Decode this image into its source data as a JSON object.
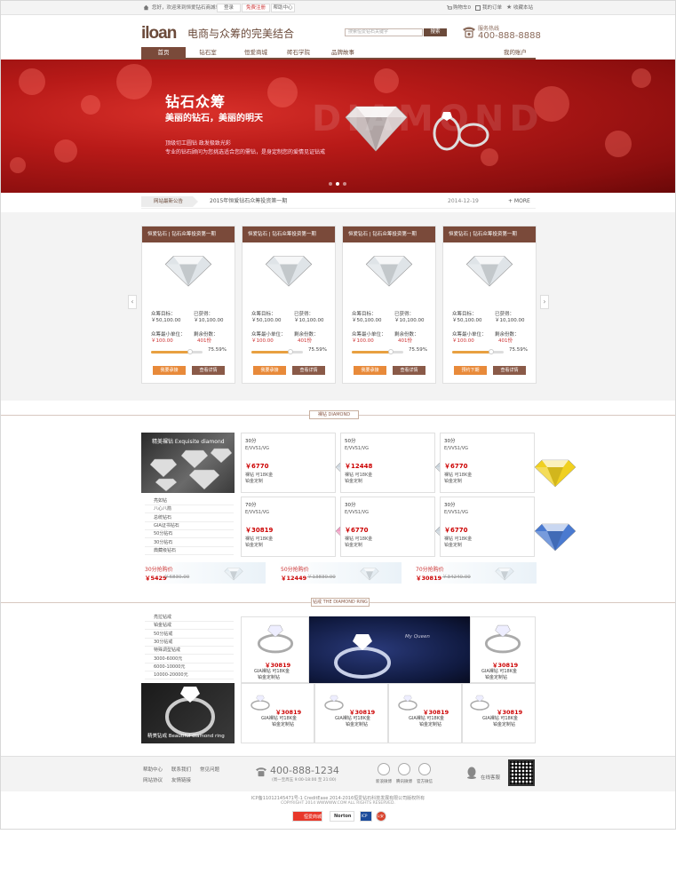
{
  "topbar": {
    "greeting": "您好，欢迎来到恒爱钻石商城！",
    "login": "登录",
    "register": "免费注册",
    "help": "帮助中心",
    "cart": "购物车0",
    "orders": "我的订单",
    "favorite": "收藏本站"
  },
  "header": {
    "logo": "iloan",
    "slogan": "电商与众筹的完美结合",
    "search_placeholder": "搜索恒爱钻石关键字",
    "search_button": "搜索",
    "hotline_label": "服务热线",
    "hotline": "400-888-8888"
  },
  "nav": {
    "items": [
      "首页",
      "钻石室",
      "恒爱商城",
      "砖石学院",
      "品牌故事"
    ],
    "account": "我的账户"
  },
  "banner": {
    "title": "钻石众筹",
    "subtitle": "美丽的钻石，美丽的明天",
    "line1": "顶级切工圆钻    政发极致光彩",
    "line2": "专业的钻石顾问为您挑选适合您的需钻，是身定制您的爱情见证钻戒",
    "bg_text": "DIAMOND"
  },
  "notice": {
    "tag": "网站最新公告",
    "text": "2015年恒爱钻石众筹投资第一期",
    "date": "2014-12-19",
    "more": "+ MORE"
  },
  "funding": {
    "labels": {
      "target": "众筹目标：",
      "raised": "已获得：",
      "min_unit": "众筹最小单位：",
      "remaining": "剩余份数："
    },
    "cards": [
      {
        "title": "恒爱钻石 | 钻石众筹投资第一期",
        "target": "￥50,100.00",
        "raised": "￥10,100.00",
        "min_unit": "￥100.00",
        "remaining": "401份",
        "progress": 75.59,
        "progress_text": "75.59%",
        "btn1": "我要承接",
        "btn2": "查看详情"
      },
      {
        "title": "恒爱钻石 | 钻石众筹投资第一期",
        "target": "￥50,100.00",
        "raised": "￥10,100.00",
        "min_unit": "￥100.00",
        "remaining": "401份",
        "progress": 75.59,
        "progress_text": "75.59%",
        "btn1": "我要承接",
        "btn2": "查看详情"
      },
      {
        "title": "恒爱钻石 | 钻石众筹投资第一期",
        "target": "￥50,100.00",
        "raised": "￥10,100.00",
        "min_unit": "￥100.00",
        "remaining": "401份",
        "progress": 75.59,
        "progress_text": "75.59%",
        "btn1": "我要承接",
        "btn2": "查看详情"
      },
      {
        "title": "恒爱钻石 | 钻石众筹投资第一期",
        "target": "￥50,100.00",
        "raised": "￥10,100.00",
        "min_unit": "￥100.00",
        "remaining": "401份",
        "progress": 75.59,
        "progress_text": "75.59%",
        "btn1": "预约下期",
        "btn2": "查看详情"
      }
    ]
  },
  "diamond": {
    "section_tag": "裸钻  DIAMOND",
    "promo": "精美裸钻 Exquisite diamond",
    "side_links": [
      "亮如钻",
      "八心八箭",
      "总统钻石",
      "GIA证书钻石",
      "50分钻石",
      "30分钻石",
      "典藏级钻石"
    ],
    "items": [
      {
        "weight": "30分",
        "grade": "E/VVS1/VG",
        "price": "￥6770",
        "desc1": "裸钻 可18K金",
        "desc2": "铂金定制",
        "color": "#cfd8e0"
      },
      {
        "weight": "50分",
        "grade": "E/VVS1/VG",
        "price": "￥12448",
        "desc1": "裸钻 可18K金",
        "desc2": "铂金定制",
        "color": "#c9d3db"
      },
      {
        "weight": "30分",
        "grade": "E/VVS1/VG",
        "price": "￥6770",
        "desc1": "裸钻 可18K金",
        "desc2": "铂金定制",
        "color": "#f0d020"
      },
      {
        "weight": "70分",
        "grade": "E/VVS1/VG",
        "price": "￥30819",
        "desc1": "裸钻 可18K金",
        "desc2": "铂金定制",
        "color": "#f09ac0"
      },
      {
        "weight": "30分",
        "grade": "E/VVS1/VG",
        "price": "￥6770",
        "desc1": "裸钻 可18K金",
        "desc2": "铂金定制",
        "color": "#c9d3db"
      },
      {
        "weight": "30分",
        "grade": "E/VVS1/VG",
        "price": "￥6770",
        "desc1": "裸钻 可18K金",
        "desc2": "铂金定制",
        "color": "#4a7ad0"
      }
    ],
    "promos": [
      {
        "title": "30分抢购价",
        "price": "￥5429",
        "old": "￥6830.00"
      },
      {
        "title": "50分抢购价",
        "price": "￥12449",
        "old": "￥13830.00"
      },
      {
        "title": "70分抢购价",
        "price": "￥30819",
        "old": "￥34240.00"
      }
    ]
  },
  "ring": {
    "section_tag": "钻戒 THE DIAMOND RING",
    "side_links": [
      "亮拉钻戒",
      "铂金钻戒",
      "50分钻戒",
      "30分钻戒",
      "特殊调型钻戒",
      "3000-6000元",
      "6000-10000元",
      "10000-20000元"
    ],
    "promo": "精美钻戒 Beautiful diamond ring",
    "banner_text": "My Queen",
    "items": [
      {
        "price": "￥30819",
        "desc1": "GIA裸钻 可18K金",
        "desc2": "铂金定制钻"
      },
      {
        "price": "￥30819",
        "desc1": "GIA裸钻 可18K金",
        "desc2": "铂金定制钻"
      },
      {
        "price": "￥30819",
        "desc1": "GIA裸钻 可18K金",
        "desc2": "铂金定制钻"
      },
      {
        "price": "￥30819",
        "desc1": "GIA裸钻 可18K金",
        "desc2": "铂金定制钻"
      },
      {
        "price": "￥30819",
        "desc1": "GIA裸钻 可18K金",
        "desc2": "铂金定制钻"
      },
      {
        "price": "￥30819",
        "desc1": "GIA裸钻 可18K金",
        "desc2": "铂金定制钻"
      }
    ]
  },
  "footer": {
    "links": [
      "帮助中心",
      "联系我们",
      "常见问题",
      "网站协议",
      "友情链接"
    ],
    "phone": "400-888-1234",
    "phone_sub": "(周一至周五 9:00-18:00 至 21:00)",
    "social": [
      "新浪微博",
      "腾讯微博",
      "官方微信"
    ],
    "qq": "在线客服",
    "copyright1": "ICP备11012145471号-1 CreditEase 2014-2016恒爱钻石科技发展有限公司版权所有",
    "copyright2": "COPYRIGHT 2014 WWWWW.COM ALL RIGHTS RESERVED.",
    "badges": [
      "恒爱商城",
      "Norton",
      "ICP",
      "公安"
    ]
  }
}
